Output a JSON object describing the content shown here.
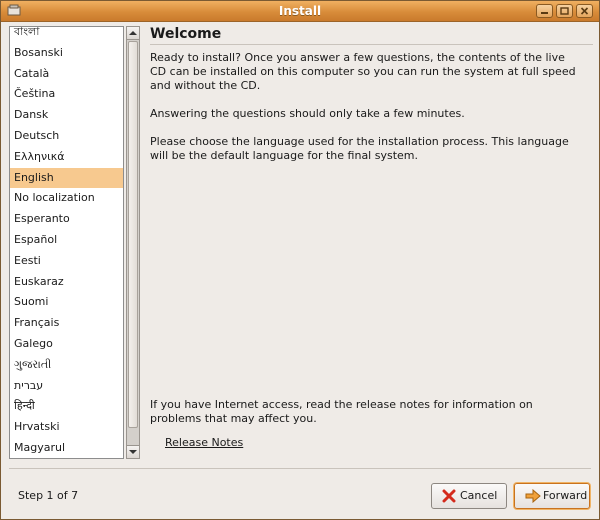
{
  "window": {
    "title": "Install"
  },
  "languages": {
    "items": [
      "বাংলা",
      "Bosanski",
      "Català",
      "Čeština",
      "Dansk",
      "Deutsch",
      "Ελληνικά",
      "English",
      "No localization",
      "Esperanto",
      "Español",
      "Eesti",
      "Euskaraz",
      "Suomi",
      "Français",
      "Galego",
      "ગુજરાતી",
      "עברית",
      "हिन्दी",
      "Hrvatski",
      "Magyarul"
    ],
    "selected": "English"
  },
  "main": {
    "heading": "Welcome",
    "para1": "Ready to install? Once you answer a few questions, the contents of the live CD can be installed on this computer so you can run the system at full speed and without the CD.",
    "para2": "Answering the questions should only take a few minutes.",
    "para3": "Please choose the language used for the installation process. This language will be the default language for the final system.",
    "para4": "If you have Internet access, read the release notes for information on problems that may affect you.",
    "release_notes": "Release Notes"
  },
  "footer": {
    "step": "Step 1 of 7",
    "cancel_label": "Cancel",
    "forward_label": "Forward"
  },
  "colors": {
    "titlebar": "#d88c3a",
    "selection": "#f7c98f"
  }
}
